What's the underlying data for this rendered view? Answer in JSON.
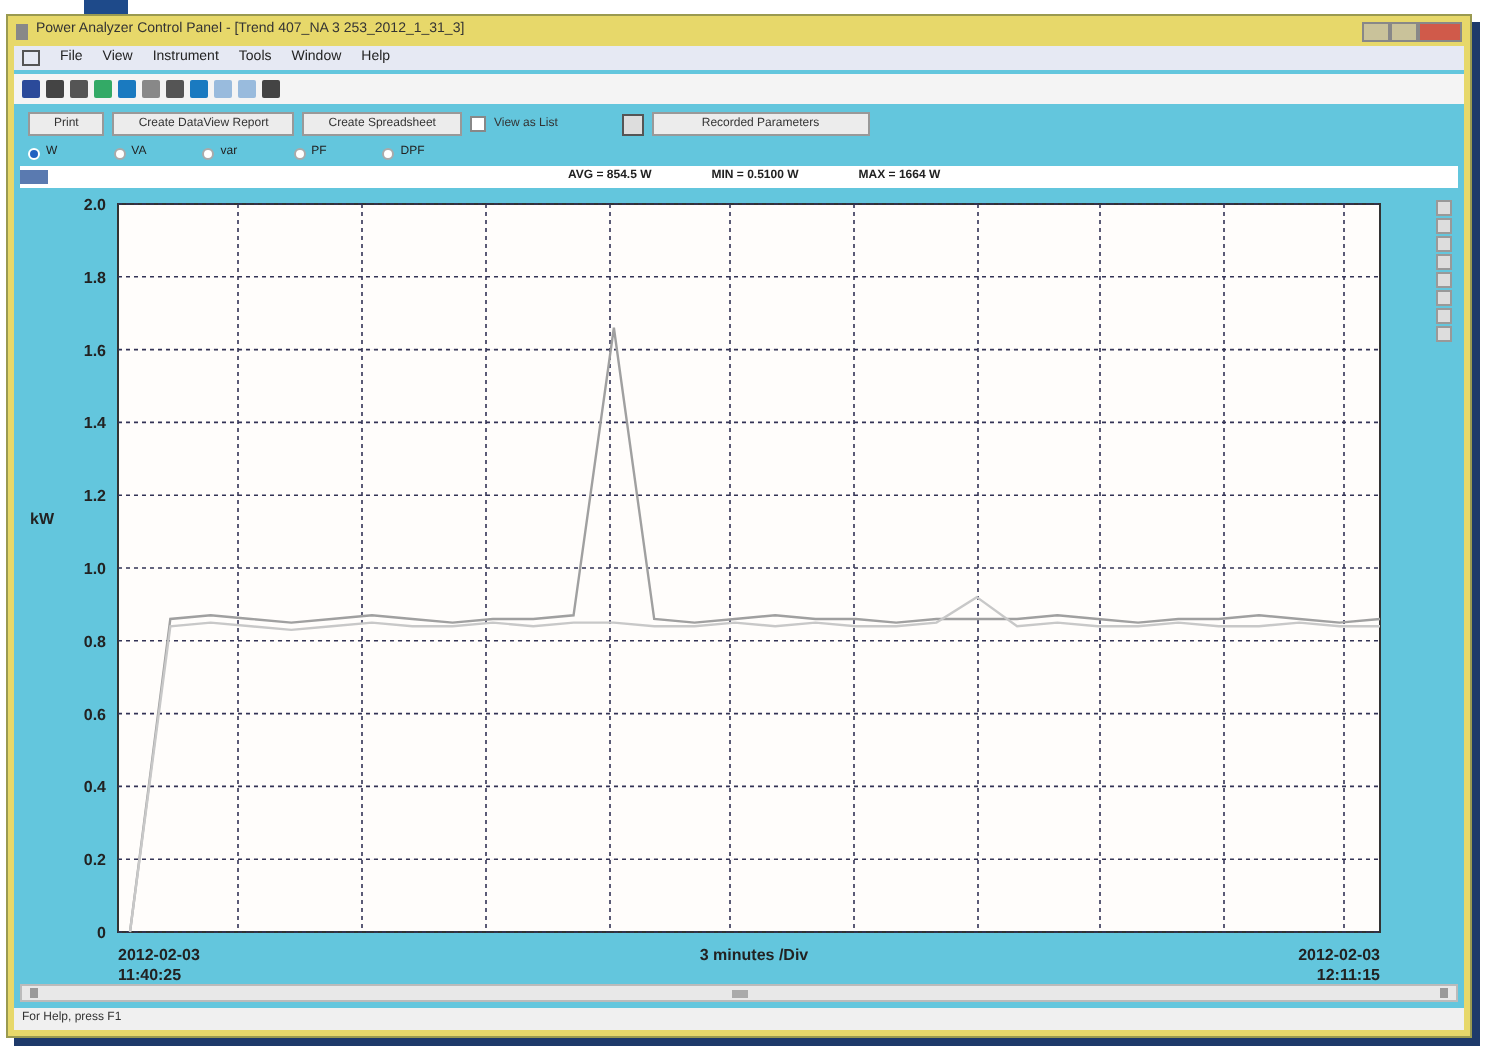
{
  "window": {
    "title": "Power Analyzer Control Panel - [Trend 407_NA 3 253_2012_1_31_3]"
  },
  "menu": [
    "File",
    "View",
    "Instrument",
    "Tools",
    "Window",
    "Help"
  ],
  "buttons": [
    "Print",
    "Create DataView Report",
    "Create Spreadsheet"
  ],
  "view_as_list": {
    "label": "View as List",
    "checked": false
  },
  "recorded_button": "Recorded Parameters",
  "radios": [
    {
      "label": "W",
      "selected": true
    },
    {
      "label": "VA",
      "selected": false
    },
    {
      "label": "var",
      "selected": false
    },
    {
      "label": "PF",
      "selected": false
    },
    {
      "label": "DPF",
      "selected": false
    }
  ],
  "stats": [
    "AVG = 854.5 W",
    "MIN = 0.5100 W",
    "MAX = 1664 W"
  ],
  "chart": {
    "start_label": [
      "2012-02-03",
      "11:40:25"
    ],
    "end_label": [
      "2012-02-03",
      "12:11:15"
    ],
    "division": "3 minutes /Div",
    "chart_data": {
      "type": "line",
      "ylabel": "kW",
      "ylim": [
        0,
        2.0
      ],
      "yticks": [
        {
          "value": 0,
          "label": "0"
        },
        {
          "value": 0.2,
          "label": "0.2"
        },
        {
          "value": 0.4,
          "label": "0.4"
        },
        {
          "value": 0.6,
          "label": "0.6"
        },
        {
          "value": 0.8,
          "label": "0.8"
        },
        {
          "value": 1.0,
          "label": "1.0"
        },
        {
          "value": 1.2,
          "label": "1.2"
        },
        {
          "value": 1.4,
          "label": "1.4"
        },
        {
          "value": 1.6,
          "label": "1.6"
        },
        {
          "value": 1.8,
          "label": "1.8"
        },
        {
          "value": 2.0,
          "label": "2.0"
        }
      ],
      "grid": true,
      "series": [
        {
          "color": "#a0a0a0",
          "values": [
            0,
            0.86,
            0.87,
            0.86,
            0.85,
            0.86,
            0.87,
            0.86,
            0.85,
            0.86,
            0.86,
            0.87,
            1.66,
            0.86,
            0.85,
            0.86,
            0.87,
            0.86,
            0.86,
            0.85,
            0.86,
            0.86,
            0.86,
            0.87,
            0.86,
            0.85,
            0.86,
            0.86,
            0.87,
            0.86,
            0.85,
            0.86
          ]
        },
        {
          "color": "#c8c8c8",
          "values": [
            0,
            0.84,
            0.85,
            0.84,
            0.83,
            0.84,
            0.85,
            0.84,
            0.84,
            0.85,
            0.84,
            0.85,
            0.85,
            0.84,
            0.84,
            0.85,
            0.84,
            0.85,
            0.84,
            0.84,
            0.85,
            0.92,
            0.84,
            0.85,
            0.84,
            0.84,
            0.85,
            0.84,
            0.84,
            0.85,
            0.84,
            0.84
          ]
        }
      ]
    }
  },
  "status_bar": "For Help, press F1"
}
